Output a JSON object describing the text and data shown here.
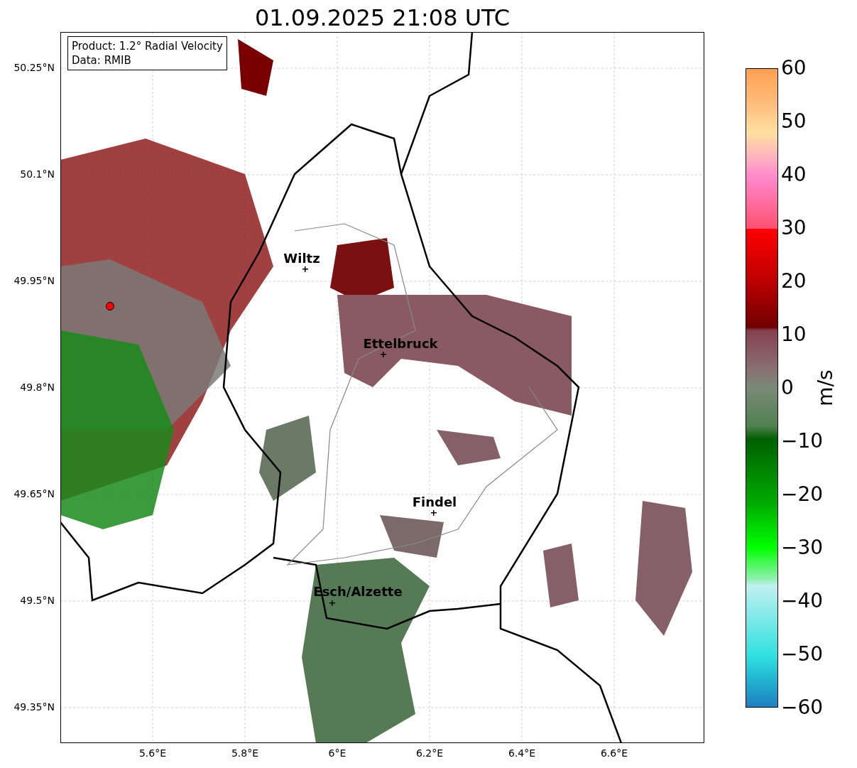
{
  "title": "01.09.2025 21:08 UTC",
  "info_box": [
    "Product: 1.2° Radial Velocity",
    "Data: RMIB"
  ],
  "y_ticks": [
    "50.25°N",
    "50.1°N",
    "49.95°N",
    "49.8°N",
    "49.65°N",
    "49.5°N",
    "49.35°N"
  ],
  "x_ticks": [
    "5.6°E",
    "5.8°E",
    "6°E",
    "6.2°E",
    "6.4°E",
    "6.6°E"
  ],
  "cities": [
    {
      "name": "Wiltz"
    },
    {
      "name": "Ettelbruck"
    },
    {
      "name": "Findel"
    },
    {
      "name": "Esch/Alzette"
    }
  ],
  "colorbar": {
    "label": "m/s",
    "ticks": [
      "60",
      "50",
      "40",
      "30",
      "20",
      "10",
      "0",
      "−10",
      "−20",
      "−30",
      "−40",
      "−50",
      "−60"
    ]
  }
}
